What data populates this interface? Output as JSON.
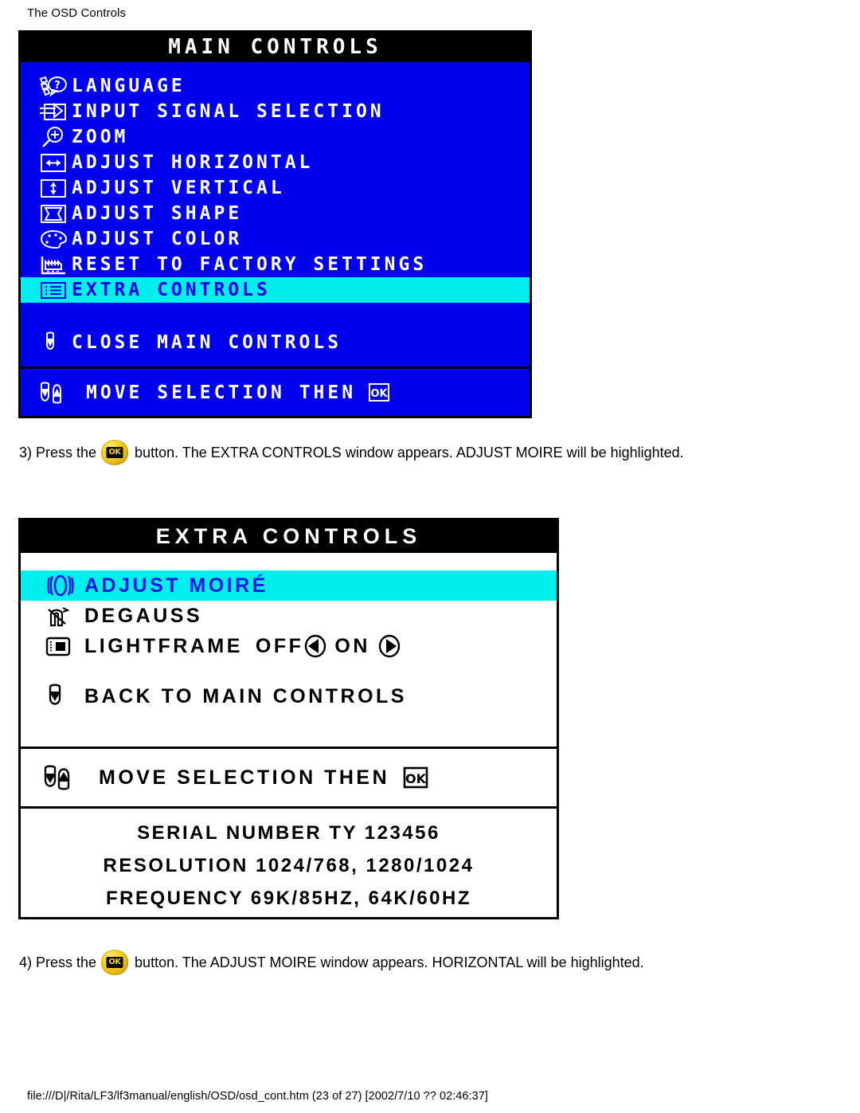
{
  "page": {
    "header": "The OSD Controls",
    "footer": "file:///D|/Rita/LF3/lf3manual/english/OSD/osd_cont.htm (23 of 27) [2002/7/10 ?? 02:46:37]"
  },
  "colors": {
    "osd_blue": "#0000EE",
    "highlight_cyan": "#00EEEE",
    "title_black": "#000000",
    "text_white": "#FFFFFF",
    "button_yellow": "#F5CF1D"
  },
  "main_controls": {
    "title": "MAIN CONTROLS",
    "items": [
      {
        "icon": "language-icon",
        "label": "LANGUAGE",
        "selected": false
      },
      {
        "icon": "input-signal-icon",
        "label": "INPUT SIGNAL SELECTION",
        "selected": false
      },
      {
        "icon": "zoom-icon",
        "label": "ZOOM",
        "selected": false
      },
      {
        "icon": "adjust-horizontal-icon",
        "label": "ADJUST HORIZONTAL",
        "selected": false
      },
      {
        "icon": "adjust-vertical-icon",
        "label": "ADJUST VERTICAL",
        "selected": false
      },
      {
        "icon": "adjust-shape-icon",
        "label": "ADJUST SHAPE",
        "selected": false
      },
      {
        "icon": "adjust-color-icon",
        "label": "ADJUST COLOR",
        "selected": false
      },
      {
        "icon": "factory-reset-icon",
        "label": "RESET TO FACTORY SETTINGS",
        "selected": false
      },
      {
        "icon": "extra-controls-icon",
        "label": "EXTRA CONTROLS",
        "selected": true
      }
    ],
    "close_item": {
      "icon": "down-arrow-icon",
      "label": "CLOSE MAIN CONTROLS"
    },
    "footer_hint": {
      "icons": "down-up-arrow-icons",
      "label": "MOVE SELECTION THEN",
      "ok_icon": "ok-icon"
    }
  },
  "step3": {
    "text_before": "3) Press the",
    "button_icon": "ok-button-icon",
    "button_label": "OK",
    "text_after": "button. The EXTRA CONTROLS window appears. ADJUST MOIRE will be highlighted."
  },
  "extra_controls": {
    "title": "EXTRA CONTROLS",
    "items": [
      {
        "icon": "adjust-moire-icon",
        "label": "ADJUST MOIRÉ",
        "selected": true
      },
      {
        "icon": "degauss-icon",
        "label": "DEGAUSS",
        "selected": false
      }
    ],
    "lightframe": {
      "icon": "lightframe-icon",
      "label": "LIGHTFRAME",
      "off_label": "OFF",
      "off_icon": "left-arrow-icon",
      "on_label": "ON",
      "on_icon": "right-arrow-icon"
    },
    "back_item": {
      "icon": "down-arrow-icon",
      "label": "BACK TO MAIN CONTROLS"
    },
    "footer_hint": {
      "icons": "down-up-arrow-icons",
      "label": "MOVE SELECTION THEN",
      "ok_icon": "ok-icon"
    },
    "info": [
      "SERIAL NUMBER TY 123456",
      "RESOLUTION 1024/768, 1280/1024",
      "FREQUENCY 69K/85HZ, 64K/60HZ"
    ]
  },
  "step4": {
    "text_before": "4) Press the",
    "button_icon": "ok-button-icon",
    "button_label": "OK",
    "text_after": "button. The ADJUST MOIRE window appears. HORIZONTAL will be highlighted."
  }
}
